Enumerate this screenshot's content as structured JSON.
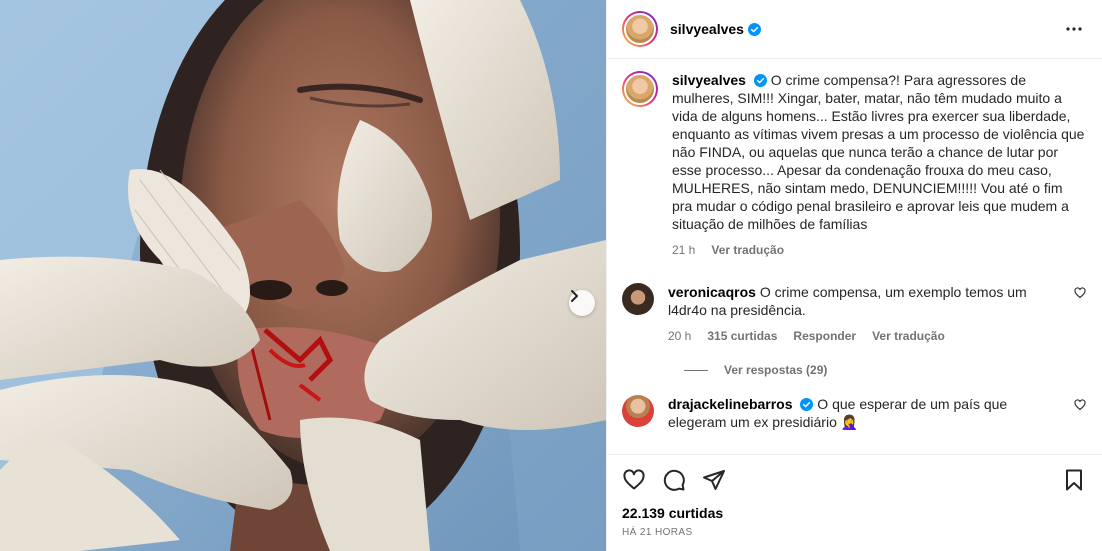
{
  "post": {
    "username": "silvyealves",
    "verified": true,
    "caption": "O crime compensa?! Para agressores de mulheres, SIM!!! Xingar, bater, matar, não têm mudado muito a vida de alguns homens... Estão livres pra exercer sua liberdade, enquanto as vítimas vivem presas a um processo de violência que não FINDA, ou aquelas que nunca terão a chance de lutar por esse processo... Apesar da condenação frouxa do meu caso, MULHERES, não sintam medo, DENUNCIEM!!!!! Vou até o fim pra mudar o código penal brasileiro e aprovar leis que mudem a situação de milhões de famílias",
    "caption_time": "21 h",
    "see_translation": "Ver tradução",
    "likes": "22.139 curtidas",
    "posted_ago": "HÁ 21 HORAS"
  },
  "comments": [
    {
      "username": "veronicaqros",
      "verified": false,
      "text": "O crime compensa, um exemplo temos um l4dr4o na presidência.",
      "time": "20 h",
      "likes": "315 curtidas",
      "reply": "Responder",
      "translate": "Ver tradução",
      "view_replies": "Ver respostas (29)"
    },
    {
      "username": "drajackelinebarros",
      "verified": true,
      "text": "O que esperar de um país que elegeram um ex presidiário 🤦‍♀️"
    }
  ],
  "icons": {
    "more": "more-horizontal-icon",
    "verified": "verified-badge-icon",
    "like": "heart-icon",
    "comment": "comment-icon",
    "share": "share-icon",
    "save": "bookmark-icon",
    "next": "chevron-right-icon"
  },
  "colors": {
    "verified": "#0095f6",
    "meta": "#737373",
    "border": "#efefef"
  }
}
